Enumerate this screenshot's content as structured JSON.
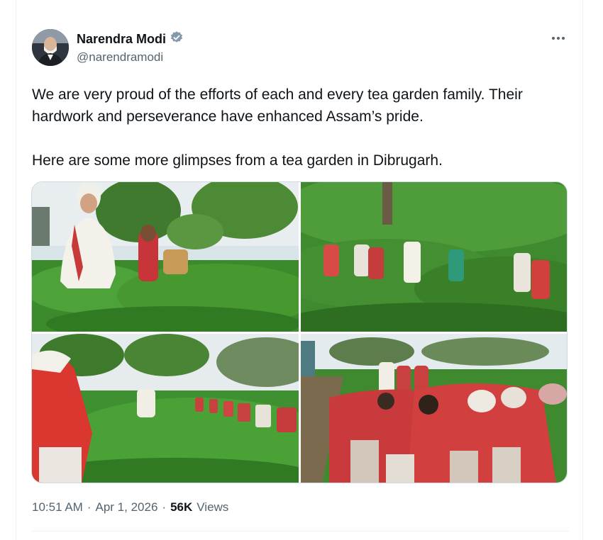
{
  "user": {
    "name": "Narendra Modi",
    "handle": "@narendramodi",
    "verified_color": "#829aab"
  },
  "tweet": {
    "text": "We are very proud of the efforts of each and every tea garden family. Their hardwork and perseverance have enhanced Assam’s pride.\n\nHere are some more glimpses from a tea garden in Dibrugarh."
  },
  "meta": {
    "time": "10:51 AM",
    "sep1": "·",
    "date": "Apr 1, 2026",
    "sep2": "·",
    "views_count": "56K",
    "views_label": "Views"
  },
  "icons": {
    "more": "more-dots-icon",
    "verified": "verified-badge-icon"
  },
  "colors": {
    "text": "#0f1419",
    "secondary": "#536471",
    "border": "#eff3f4"
  }
}
